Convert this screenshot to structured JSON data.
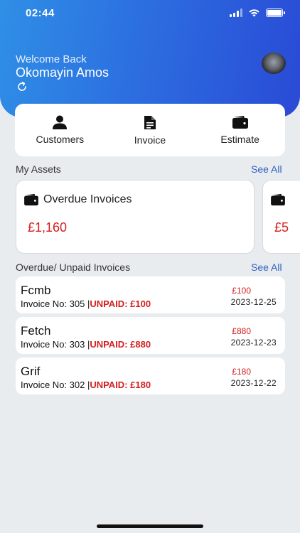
{
  "status_bar": {
    "time": "02:44"
  },
  "header": {
    "welcome": "Welcome Back",
    "user_name": "Okomayin Amos"
  },
  "quick_actions": [
    {
      "label": "Customers",
      "icon": "person-icon"
    },
    {
      "label": "Invoice",
      "icon": "document-icon"
    },
    {
      "label": "Estimate",
      "icon": "wallet-icon"
    }
  ],
  "assets": {
    "title": "My Assets",
    "see_all": "See All",
    "cards": [
      {
        "title": "Overdue Invoices",
        "amount": "£1,160"
      },
      {
        "title": "",
        "amount": "£5"
      }
    ]
  },
  "unpaid": {
    "title": "Overdue/ Unpaid Invoices",
    "see_all": "See All",
    "rows": [
      {
        "name": "Fcmb",
        "invoice_text": "Invoice No: 305 |",
        "unpaid_text": "UNPAID: £100",
        "amount": "£100",
        "date": "2023-12-25"
      },
      {
        "name": "Fetch",
        "invoice_text": "Invoice No: 303 |",
        "unpaid_text": "UNPAID: £880",
        "amount": "£880",
        "date": "2023-12-23"
      },
      {
        "name": "Grif",
        "invoice_text": "Invoice No: 302 |",
        "unpaid_text": "UNPAID: £180",
        "amount": "£180",
        "date": "2023-12-22"
      }
    ]
  },
  "colors": {
    "header_gradient_start": "#2f8fe6",
    "header_gradient_end": "#2a4ad6",
    "accent_link": "#2e5fc1",
    "alert_red": "#d41f1f",
    "background": "#e9ecef"
  }
}
